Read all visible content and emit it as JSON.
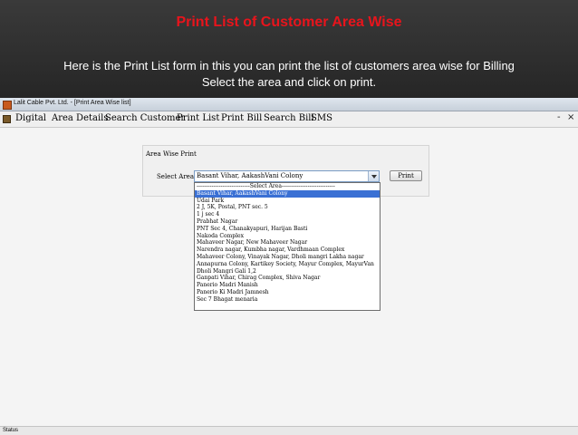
{
  "slide": {
    "title": "Print List of Customer Area Wise",
    "description_line1": "Here is the Print List form in this you can print the list of customers area wise for Billing",
    "description_line2": "Select the area and click on print."
  },
  "window": {
    "title": "Lalit Cable Pvt. Ltd. - [Print Area Wise list]"
  },
  "menu": {
    "items": [
      "Digital",
      "Area Details",
      "Search Customer",
      "Print List",
      "Print Bill",
      "Search Bill",
      "SMS"
    ],
    "minimize": "-",
    "restore": "×"
  },
  "form": {
    "panel_title": "Area Wise Print",
    "select_label": "Select Area",
    "selected_value": "Basant Vihar, AakashVani Colony",
    "print_button": "Print"
  },
  "dropdown": {
    "options": [
      "-----------------------------Select Area-----------------------------",
      "Basant Vihar, AakashVani Colony",
      "Udai Park",
      "2 J, 5K, Postal, PNT sec. 5",
      "1 j sec 4",
      "Prabhat Nagar",
      "PNT Sec 4, Chanakyapuri, Harijan Basti",
      "Nakoda Complex",
      "Mahaveer Nagar, New Mahaveer Nagar",
      "Narendra nagar, Kumbha nagar, Vardhmaan Complex",
      "Mahaveer Colony, Vinayak Nagar, Dholi mangri Lakha nagar",
      "Annapurna Colony, Kartikey Society, Mayur Complex, MayurVan",
      "Dholi Mangri Gali 1,2",
      "Ganpati Vihar, Chirag Complex, Shiva Nagar",
      "Panerio Madri Manish",
      "Panerio Ki Madri Jamnesh",
      "Sec 7 Bhagat menaria"
    ],
    "selected_index": 1
  },
  "status": {
    "text": "Status"
  },
  "colors": {
    "slide_title": "#e8141c",
    "selection": "#3a70d4"
  }
}
